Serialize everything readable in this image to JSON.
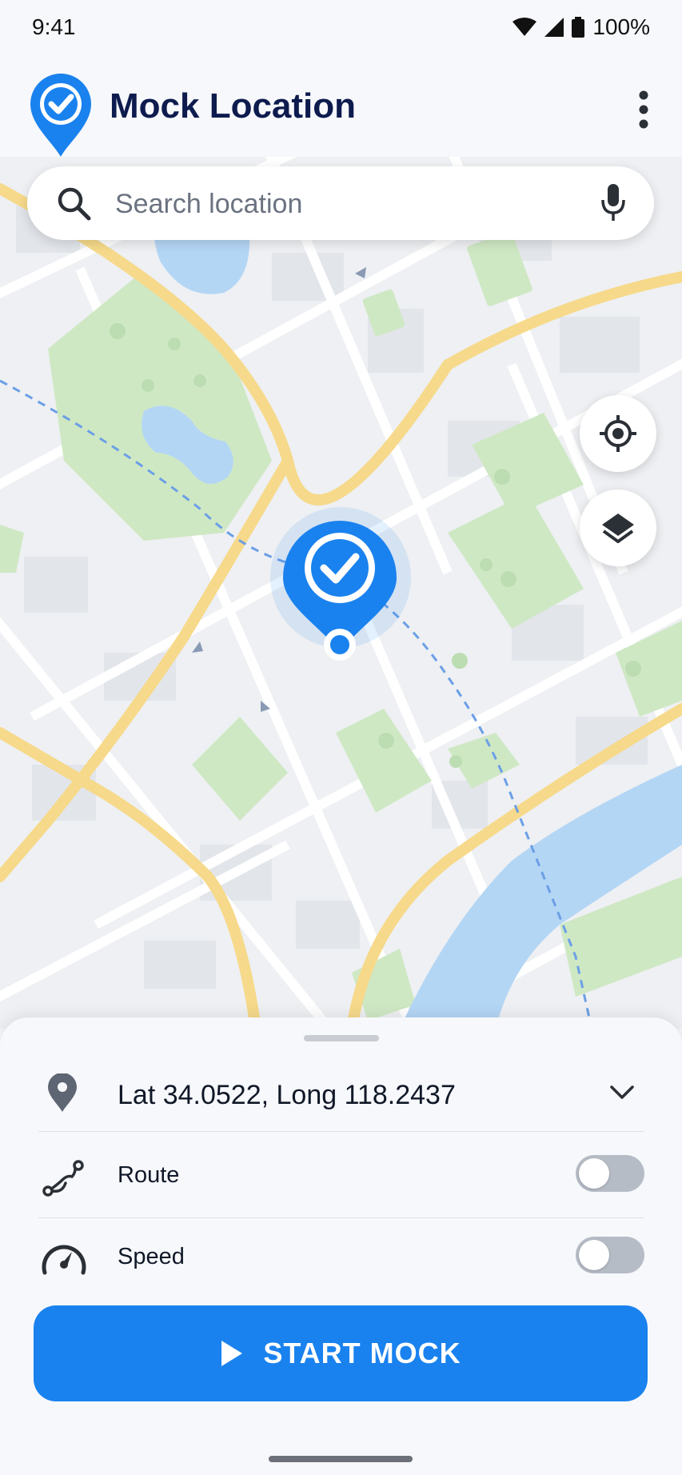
{
  "status_bar": {
    "time": "9:41",
    "battery": "100%",
    "icons": [
      "wifi-icon",
      "signal-icon",
      "battery-icon"
    ]
  },
  "app_bar": {
    "title": "Mock Location",
    "logo_icon": "location-check-icon",
    "menu_icon": "more-vert-icon"
  },
  "search": {
    "placeholder": "Search location",
    "value": "",
    "left_icon": "search-icon",
    "right_icon": "mic-icon"
  },
  "map": {
    "controls": [
      "my-location-icon",
      "layers-icon"
    ],
    "pin_icon": "location-check-pin-icon"
  },
  "sheet": {
    "location": {
      "text": "Lat 34.0522, Long 118.2437",
      "icon": "place-icon",
      "expand_icon": "chevron-down-icon"
    },
    "options": [
      {
        "label": "Route",
        "icon": "route-icon",
        "enabled": false
      },
      {
        "label": "Speed",
        "icon": "speedometer-icon",
        "enabled": false
      }
    ],
    "start_button": {
      "label": "START MOCK",
      "icon": "play-icon"
    }
  },
  "colors": {
    "primary": "#1a82ee",
    "title": "#0d1b4e",
    "road": "#f6d98a",
    "park": "#cfe8c4",
    "water": "#b4d6f5",
    "route": "#6b9fe6"
  }
}
